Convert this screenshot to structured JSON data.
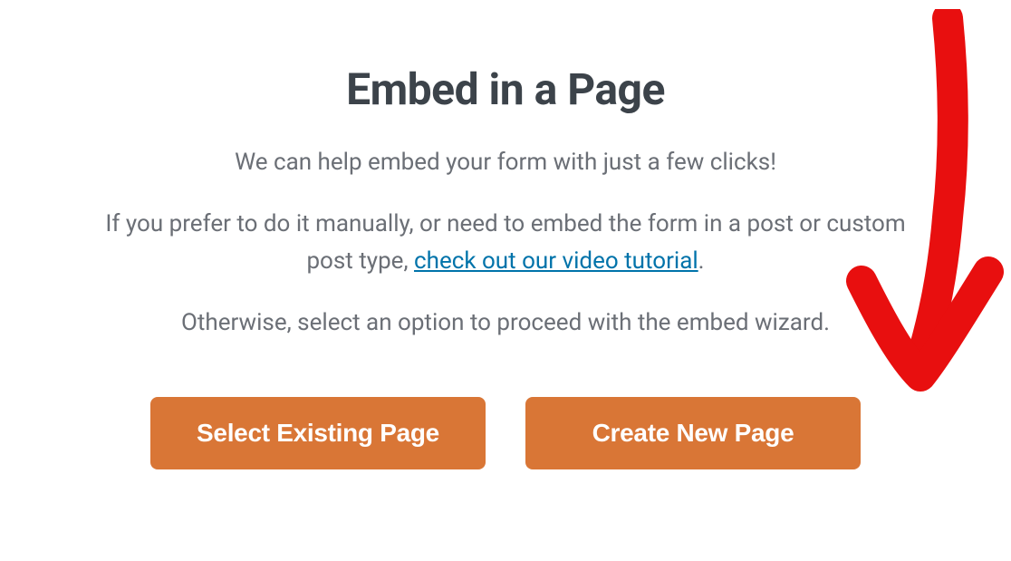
{
  "modal": {
    "title": "Embed in a Page",
    "intro": "We can help embed your form with just a few clicks!",
    "paragraph_prefix": "If you prefer to do it manually, or need to embed the form in a post or custom post type, ",
    "link_text": "check out our video tutorial",
    "paragraph_suffix": ".",
    "wizard_text": "Otherwise, select an option to proceed with the embed wizard.",
    "buttons": {
      "select_existing": "Select Existing Page",
      "create_new": "Create New Page"
    }
  },
  "colors": {
    "button_bg": "#d97636",
    "link": "#0073aa",
    "heading": "#3c434a",
    "body_text": "#6b6f76",
    "annotation": "#e80f0f"
  }
}
